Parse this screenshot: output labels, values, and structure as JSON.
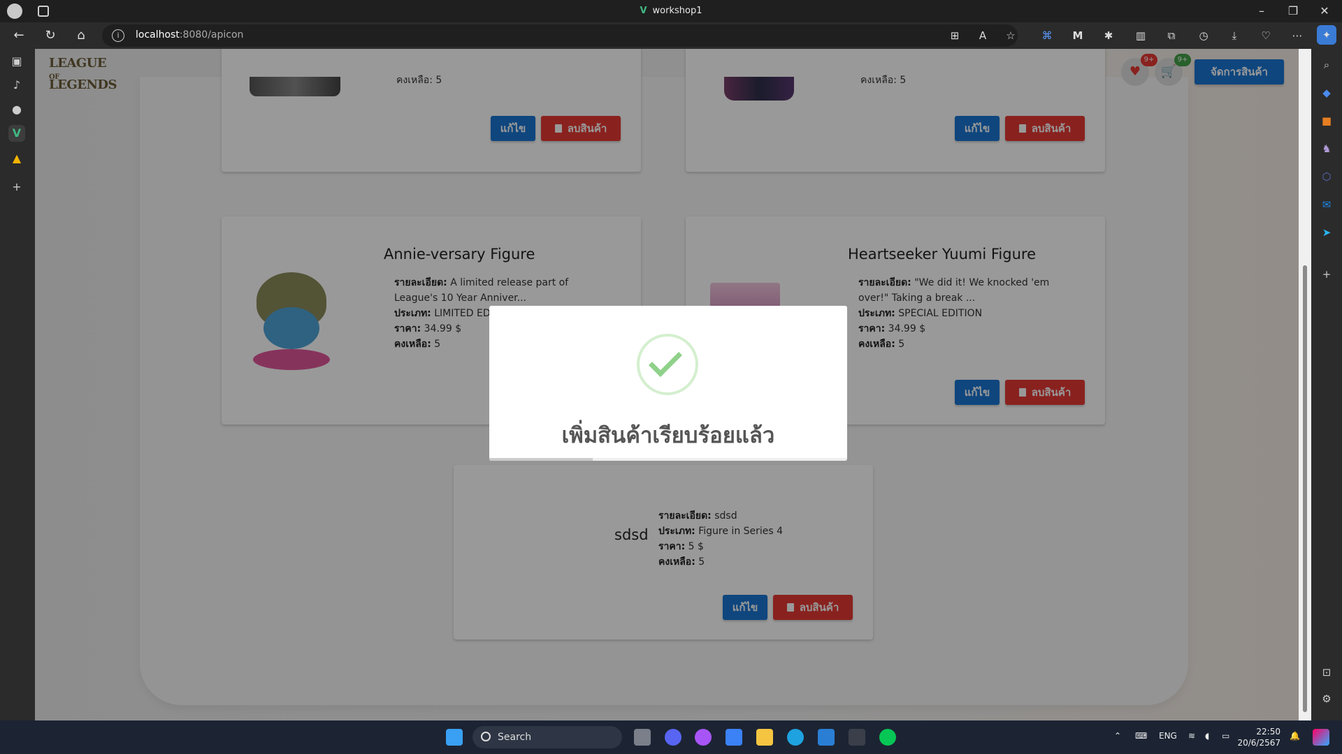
{
  "window": {
    "title": "workshop1",
    "title_logo": "V"
  },
  "browser": {
    "url_host": "localhost",
    "url_rest": ":8080/apicon"
  },
  "header": {
    "logo_line1": "LEAGUE",
    "logo_of": "OF",
    "logo_line2": "LEGENDS",
    "wishlist_badge": "9+",
    "cart_badge": "9+",
    "manage_button": "จัดการสินค้า"
  },
  "labels": {
    "detail": "รายละเอียด:",
    "type": "ประเภท:",
    "price": "ราคา:",
    "stock": "คงเหลือ:",
    "edit": "แก้ไข",
    "delete": "ลบสินค้า"
  },
  "cards": [
    {
      "title": "",
      "stock_partial": "คงเหลือ: 5"
    },
    {
      "title": "",
      "stock_partial": "คงเหลือ: 5"
    },
    {
      "title": "Annie-versary Figure",
      "detail": "A limited release part of League's 10 Year Anniver...",
      "type": "LIMITED EDITION",
      "price": "34.99 $",
      "stock": "5"
    },
    {
      "title": "Heartseeker Yuumi Figure",
      "detail": "\"We did it! We knocked 'em over!\" Taking a break ...",
      "type": "SPECIAL EDITION",
      "price": "34.99 $",
      "stock": "5"
    },
    {
      "title": "sdsd",
      "detail": "sdsd",
      "type": "Figure in Series 4",
      "price": "5 $",
      "stock": "5"
    }
  ],
  "modal": {
    "message": "เพิ่มสินค้าเรียบร้อยแล้ว",
    "icon": "success-check",
    "progress": 0.29
  },
  "taskbar": {
    "search_label": "Search",
    "lang": "ENG",
    "time": "22:50",
    "date": "20/6/2567"
  },
  "colors": {
    "primary": "#1976d2",
    "danger": "#e53935",
    "success": "#8fd18a",
    "wishlist_badge": "#e53935",
    "cart_badge": "#43a047"
  }
}
